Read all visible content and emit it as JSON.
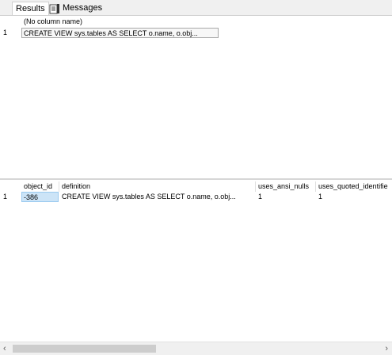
{
  "tabs": {
    "results_label": "Results",
    "messages_label": "Messages"
  },
  "grid1": {
    "header": "(No column name)",
    "rows": [
      {
        "num": "1",
        "value": "CREATE VIEW sys.tables AS   SELECT o.name, o.obj..."
      }
    ]
  },
  "grid2": {
    "headers": [
      "object_id",
      "definition",
      "uses_ansi_nulls",
      "uses_quoted_identifie"
    ],
    "rows": [
      {
        "num": "1",
        "object_id": "-386",
        "definition": "CREATE VIEW sys.tables AS   SELECT o.name, o.obj...",
        "uses_ansi_nulls": "1",
        "uses_quoted_identifier": "1"
      }
    ]
  },
  "scrollbar": {
    "left_arrow": "‹",
    "right_arrow": "›"
  }
}
